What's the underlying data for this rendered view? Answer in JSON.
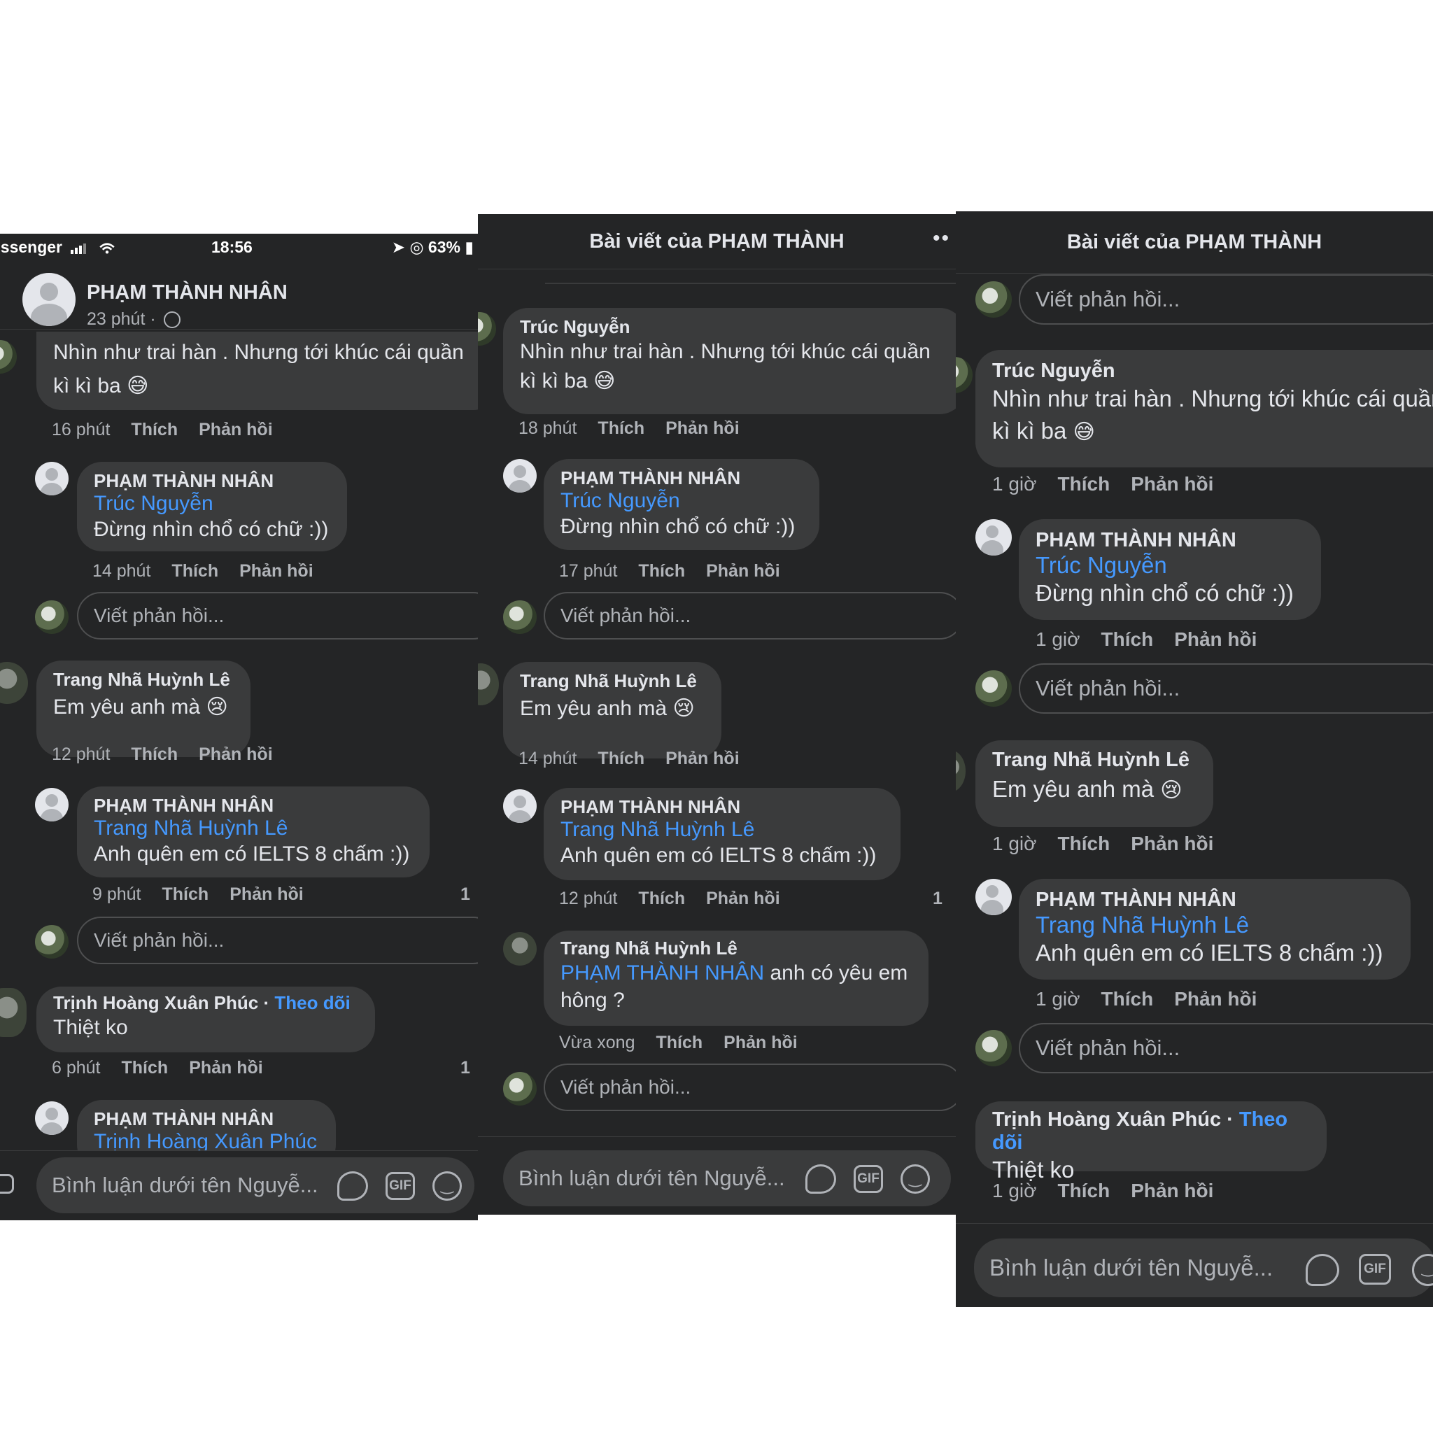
{
  "status_bar": {
    "carrier": "essenger",
    "time": "18:56",
    "battery": "63%"
  },
  "post": {
    "author": "PHẠM THÀNH NHÂN",
    "time": "23 phút",
    "dot": "·"
  },
  "header_title": "Bài viết của PHẠM THÀNH",
  "more_icon": "••",
  "labels": {
    "like": "Thích",
    "reply": "Phản hồi",
    "write_reply": "Viết phản hồi...",
    "composer": "Bình luận dưới tên Nguyễ...",
    "gif": "GIF",
    "follow": "Theo dõi",
    "dot": "·",
    "count": "1"
  },
  "names": {
    "truc": "Trúc Nguyễn",
    "pham": "PHẠM THÀNH NHÂN",
    "trang": "Trang Nhã Huỳnh Lê",
    "trinh": "Trịnh Hoàng Xuân Phúc"
  },
  "texts": {
    "truc_1": "Nhìn như trai hàn . Nhưng tới khúc cái quần",
    "truc_2": "kì kì ba",
    "pham_truc": "Đừng nhìn chổ có chữ :))",
    "trang": "Em yêu anh mà",
    "pham_trang": "Anh quên em có IELTS 8 chấm :))",
    "trang_pham_1": "anh có yêu em",
    "trang_pham_2": "hông ?",
    "trinh": "Thiệt ko"
  },
  "emoji": {
    "sweat": "😅",
    "cry": "😢"
  },
  "panel1": {
    "t_truc": "16 phút",
    "t_pham1": "14 phút",
    "t_trang": "12 phút",
    "t_pham2": "9 phút",
    "t_trinh": "6 phút"
  },
  "panel2": {
    "t_truc": "18 phút",
    "t_pham1": "17 phút",
    "t_trang": "14 phút",
    "t_pham2": "12 phút",
    "t_trang2": "Vừa xong"
  },
  "panel3": {
    "t_all": "1 giờ"
  }
}
